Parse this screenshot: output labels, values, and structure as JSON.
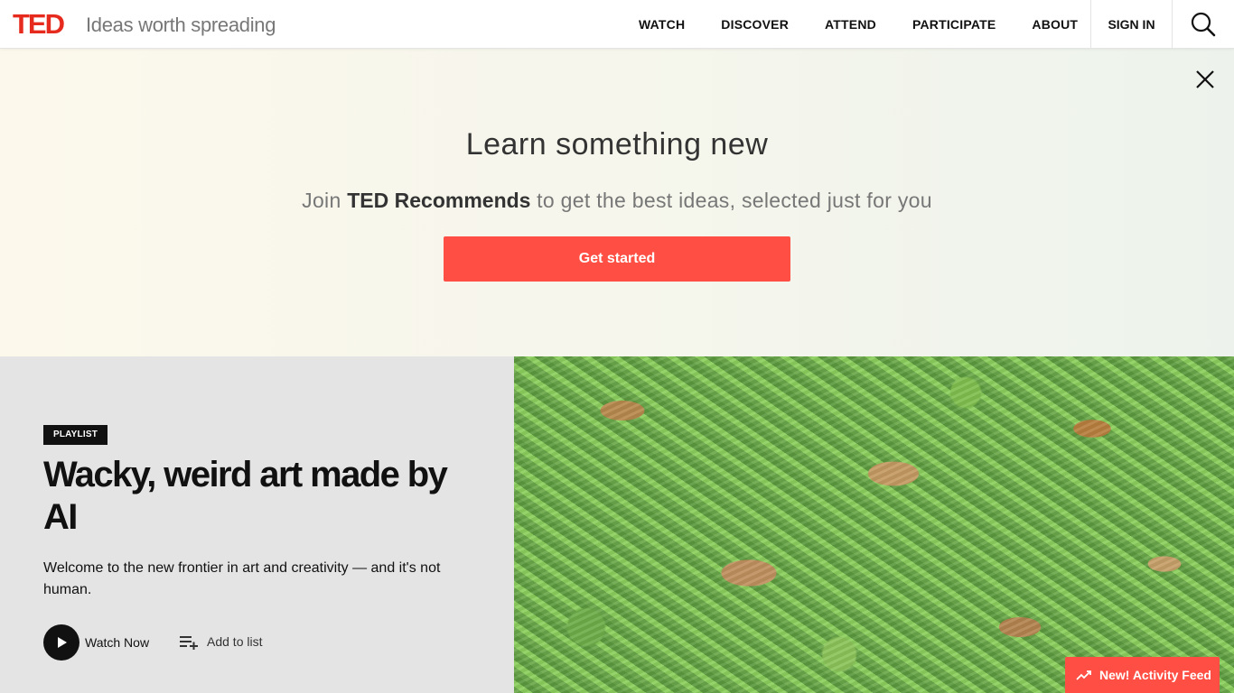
{
  "header": {
    "logo": "TED",
    "tagline": "Ideas worth spreading",
    "nav": [
      "WATCH",
      "DISCOVER",
      "ATTEND",
      "PARTICIPATE",
      "ABOUT"
    ],
    "signin": "SIGN IN",
    "search_icon": "search-icon"
  },
  "banner": {
    "title": "Learn something new",
    "subtitle_prefix": "Join ",
    "subtitle_bold": "TED Recommends",
    "subtitle_suffix": " to get the best ideas, selected just for you",
    "cta": "Get started",
    "close_icon": "close-icon"
  },
  "hero": {
    "badge": "PLAYLIST",
    "title": "Wacky, weird art made by AI",
    "description": "Welcome to the new frontier in art and creativity — and it's not human.",
    "watch_label": "Watch Now",
    "add_label": "Add to list"
  },
  "activity": {
    "label": "New! Activity Feed",
    "icon": "trending-icon"
  },
  "colors": {
    "brand": "#e62b1e",
    "cta": "#ff4f44"
  }
}
